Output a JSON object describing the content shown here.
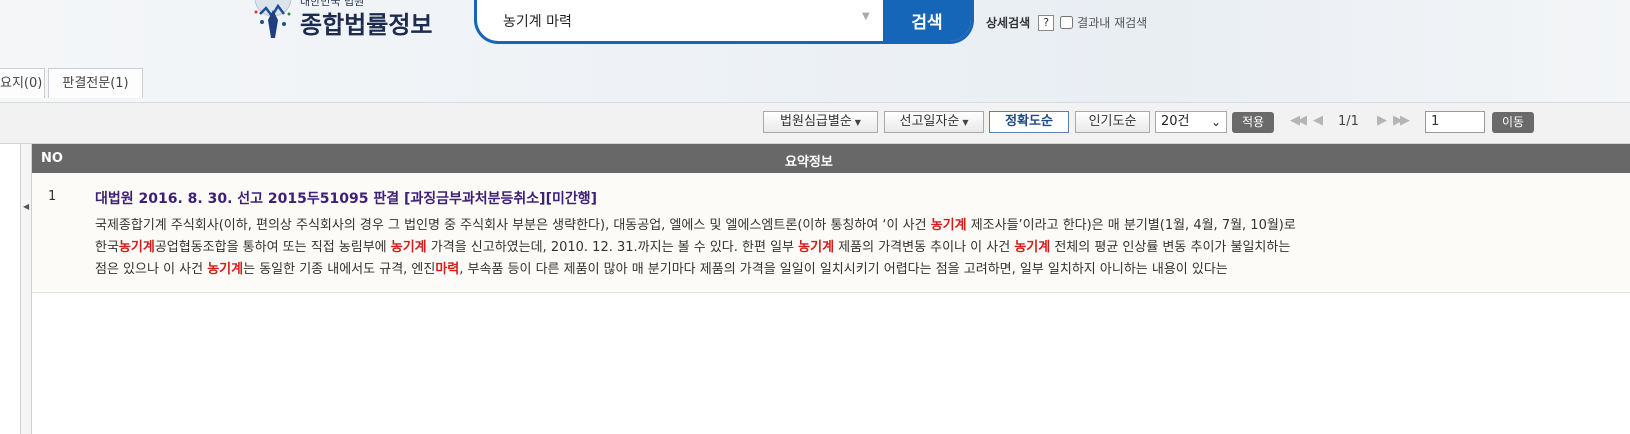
{
  "header": {
    "logo_subtitle": "대한민국 법원",
    "logo_title": "종합법률정보",
    "search_value": "농기계 마력",
    "search_button": "검색",
    "advanced_search": "상세검색",
    "help": "?",
    "search_within_results": "결과내 재검색"
  },
  "tabs": [
    {
      "label": "요지(0)"
    },
    {
      "label": "판결전문(1)"
    }
  ],
  "toolbar": {
    "sort_court": "법원심급별순",
    "sort_date": "선고일자순",
    "sort_accuracy": "정확도순",
    "sort_popularity": "인기도순",
    "page_size": "20건",
    "apply": "적용",
    "page_info": "1/1",
    "page_input": "1",
    "go": "이동"
  },
  "table": {
    "col_no": "NO",
    "col_summary": "요약정보",
    "rows": [
      {
        "no": "1",
        "title": "대법원 2016. 8. 30. 선고 2015두51095 판결 [과징금부과처분등취소][미간행]",
        "summary_lines": [
          [
            {
              "t": "국제종합기계 주식회사(이하, 편의상 주식회사의 경우 그 법인명 중 주식회사 부분은 생략한다), 대동공업, 엘에스 및 엘에스엠트론(이하 통칭하여 ‘이 사건 "
            },
            {
              "t": "농기계",
              "hl": true
            },
            {
              "t": " 제조사들’이라고 한다)은 매 분기별(1월, 4월, 7월, 10월)로"
            }
          ],
          [
            {
              "t": "한국"
            },
            {
              "t": "농기계",
              "hl": true
            },
            {
              "t": "공업협동조합을 통하여 또는 직접 농림부에 "
            },
            {
              "t": "농기계",
              "hl": true
            },
            {
              "t": " 가격을 신고하였는데, 2010. 12. 31.까지는 볼 수 있다. 한편 일부 "
            },
            {
              "t": "농기계",
              "hl": true
            },
            {
              "t": " 제품의 가격변동 추이나 이 사건 "
            },
            {
              "t": "농기계",
              "hl": true
            },
            {
              "t": " 전체의 평균 인상률 변동 추이가 불일치하는"
            }
          ],
          [
            {
              "t": "점은 있으나 이 사건 "
            },
            {
              "t": "농기계",
              "hl": true
            },
            {
              "t": "는 동일한 기종 내에서도 규격, 엔진"
            },
            {
              "t": "마력",
              "hl": true
            },
            {
              "t": ", 부속품 등이 다른 제품이 많아 매 분기마다 제품의 가격을 일일이 일치시키기 어렵다는 점을 고려하면, 일부 일치하지 아니하는 내용이 있다는"
            }
          ]
        ]
      }
    ]
  },
  "colors": {
    "search_blue": "#1565b8",
    "header_gray": "#686868",
    "highlight_red": "#d41c1c",
    "title_purple": "#3e1f78"
  }
}
